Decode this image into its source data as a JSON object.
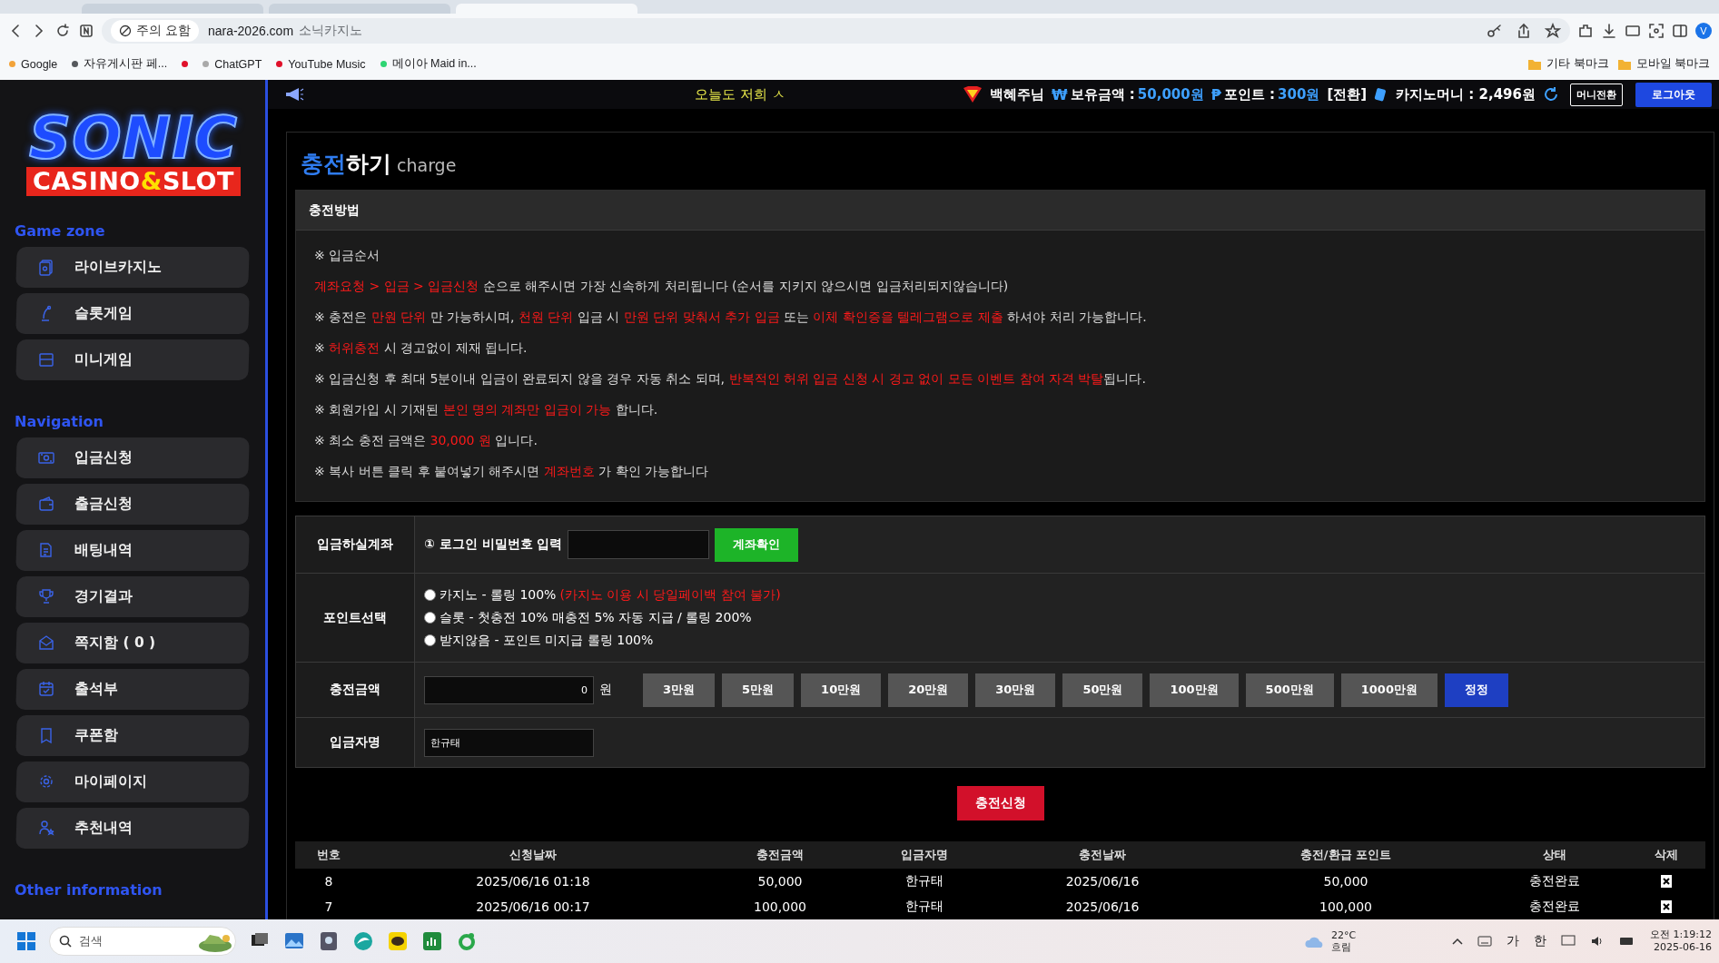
{
  "browser": {
    "tabs": [
      {
        "selected": false
      },
      {
        "selected": false
      },
      {
        "selected": true
      }
    ],
    "security_chip": "주의 요함",
    "url": "nara-2026.com",
    "page_title": "소닉카지노",
    "profile_initial": "V",
    "bookmarks": [
      {
        "label": "Google",
        "color": "#f2a33a"
      },
      {
        "label": "자유게시판 페...",
        "color": "#55585c"
      },
      {
        "color": "#e0102a"
      },
      {
        "label": "ChatGPT",
        "color": "#a9a9a9"
      },
      {
        "label": "YouTube Music",
        "color": "#e0102a"
      },
      {
        "label": "메이아 Maid in...",
        "color": "#2ed573"
      }
    ],
    "bookmark_folders": [
      "기타 북마크",
      "모바일 북마크"
    ]
  },
  "logo": {
    "title": "SONIC",
    "subtitle": [
      {
        "text": "CASINO",
        "highlight": false
      },
      {
        "text": "&",
        "highlight": true
      },
      {
        "text": "SLOT",
        "highlight": false
      }
    ]
  },
  "sidebar": {
    "sections": [
      {
        "title": "Game zone",
        "items": [
          "라이브카지노",
          "슬롯게임",
          "미니게임"
        ]
      },
      {
        "title": "Navigation",
        "items": [
          "입금신청",
          "출금신청",
          "배팅내역",
          "경기결과",
          "쪽지함 ( 0 )",
          "출석부",
          "쿠폰함",
          "마이페이지",
          "추천내역"
        ]
      },
      {
        "title": "Other information"
      }
    ]
  },
  "header": {
    "marquee": "오늘도 저희 ㅅ",
    "user_name": "백혜주님",
    "balance_symbol": "₩",
    "balance_label": "보유금액 : ",
    "balance": "50,000원",
    "points_symbol": "₱",
    "points_label": "포인트 : ",
    "points": "300원",
    "points_convert": "[전환]",
    "casino_money": "카지노머니 : 2,496원",
    "money_convert_button": "머니전환",
    "logout_button": "로그아웃"
  },
  "page_title": {
    "highlight": "충전",
    "rest": "하기",
    "subtitle": "charge"
  },
  "notice": {
    "title": "충전방법",
    "lines": [
      [
        {
          "text": "※ 입금순서",
          "highlight": false
        }
      ],
      [
        {
          "text": "계좌요청 > 입금 > 입금신청",
          "highlight": true
        },
        {
          "text": " 순으로 해주시면 가장 신속하게 처리됩니다 (순서를 지키지 않으시면 입금처리되지않습니다)",
          "highlight": false
        }
      ],
      [
        {
          "text": "※ 충전은 ",
          "highlight": false
        },
        {
          "text": "만원 단위",
          "highlight": true
        },
        {
          "text": " 만 가능하시며, ",
          "highlight": false
        },
        {
          "text": "천원 단위",
          "highlight": true
        },
        {
          "text": " 입금 시 ",
          "highlight": false
        },
        {
          "text": "만원 단위 맞춰서 추가 입금",
          "highlight": true
        },
        {
          "text": " 또는 ",
          "highlight": false
        },
        {
          "text": "이체 확인증을 텔레그램으로 제출",
          "highlight": true
        },
        {
          "text": " 하셔야 처리 가능합니다.",
          "highlight": false
        }
      ],
      [
        {
          "text": "※ ",
          "highlight": false
        },
        {
          "text": "허위충전",
          "highlight": true
        },
        {
          "text": " 시 경고없이 제재 됩니다.",
          "highlight": false
        }
      ],
      [
        {
          "text": "※ 입금신청 후 최대 5분이내 입금이 완료되지 않을 경우 자동 취소 되며, ",
          "highlight": false
        },
        {
          "text": "반복적인 허위 입금 신청 시 경고 없이 모든 이벤트 참여 자격 박탈",
          "highlight": true
        },
        {
          "text": "됩니다.",
          "highlight": false
        }
      ],
      [
        {
          "text": "※ 회원가입 시 기재된 ",
          "highlight": false
        },
        {
          "text": "본인 명의 계좌만 입금이 가능",
          "highlight": true
        },
        {
          "text": " 합니다.",
          "highlight": false
        }
      ],
      [
        {
          "text": "※ 최소 충전 금액은 ",
          "highlight": false
        },
        {
          "text": "30,000 원",
          "highlight": true
        },
        {
          "text": " 입니다.",
          "highlight": false
        }
      ],
      [
        {
          "text": "※ 복사 버튼 클릭 후 붙여넣기 해주시면 ",
          "highlight": false
        },
        {
          "text": "계좌번호",
          "highlight": true
        },
        {
          "text": " 가 확인 가능합니다",
          "highlight": false
        }
      ]
    ]
  },
  "form": {
    "account": {
      "label": "입금하실계좌",
      "prompt": "① 로그인 비밀번호 입력",
      "button": "계좌확인"
    },
    "points": {
      "label": "포인트선택",
      "options": [
        {
          "text": "카지노 - 롤링 100%",
          "note": "(카지노 이용 시 당일페이백 참여 불가)",
          "selected": false
        },
        {
          "text": "슬롯 - 첫충전 10% 매충전 5% 자동 지급 / 롤링 200%",
          "selected": false
        },
        {
          "text": "받지않음 - 포인트 미지급 롤링 100%",
          "selected": false
        }
      ]
    },
    "amount": {
      "label": "충전금액",
      "value": "0",
      "unit": "원",
      "quick_buttons": [
        "3만원",
        "5만원",
        "10만원",
        "20만원",
        "30만원",
        "50만원",
        "100만원",
        "500만원",
        "1000만원"
      ],
      "reset_button": "정정"
    },
    "depositor": {
      "label": "입금자명",
      "value": "한규태"
    },
    "submit": "충전신청"
  },
  "history": {
    "columns": [
      "번호",
      "신청날짜",
      "충전금액",
      "입금자명",
      "충전날짜",
      "충전/환급 포인트",
      "상태",
      "삭제"
    ],
    "rows": [
      [
        "8",
        "2025/06/16 01:18",
        "50,000",
        "한규태",
        "2025/06/16",
        "50,000",
        "충전완료"
      ],
      [
        "7",
        "2025/06/16 00:17",
        "100,000",
        "한규태",
        "2025/06/16",
        "100,000",
        "충전완료"
      ]
    ]
  },
  "taskbar": {
    "search_placeholder": "검색",
    "temperature": "22°C",
    "weather": "흐림",
    "ime_mode": "가",
    "ime_lang": "한",
    "time": "오전 1:19:12",
    "date": "2025-06-16"
  }
}
